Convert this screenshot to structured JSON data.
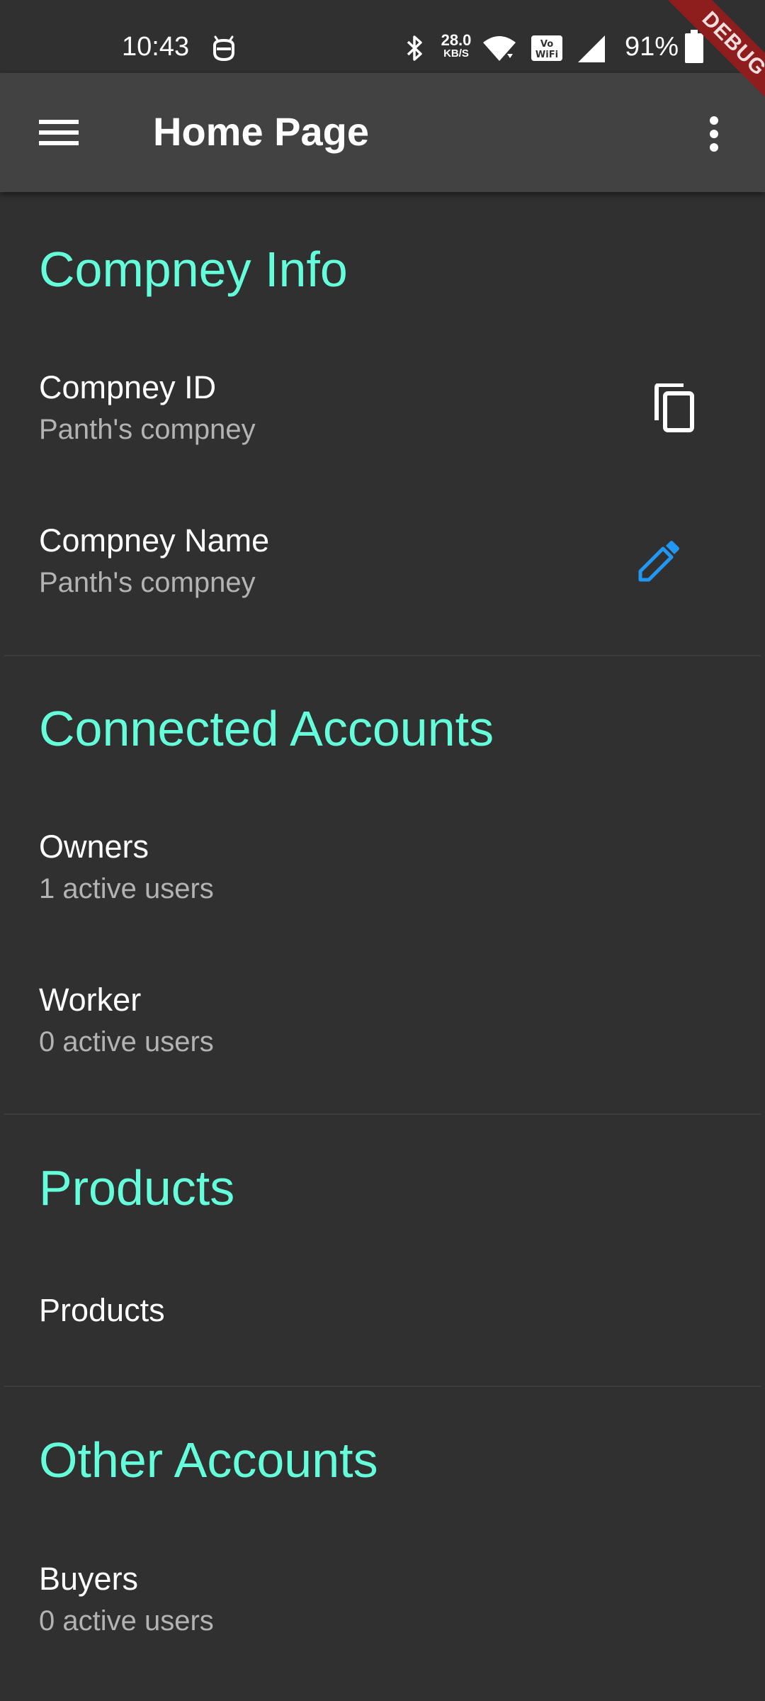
{
  "status_bar": {
    "time": "10:43",
    "net_speed_value": "28.0",
    "net_speed_unit": "KB/S",
    "battery_percent": "91%",
    "icons": [
      "android-face-icon",
      "bluetooth-icon",
      "wifi-icon",
      "vowifi-icon",
      "cell-signal-icon",
      "battery-icon"
    ]
  },
  "debug_banner": "DEBUG",
  "app_bar": {
    "title": "Home Page",
    "leading_icon": "menu-icon",
    "trailing_icon": "more-vert-icon"
  },
  "sections": {
    "company_info": {
      "title": "Compney Info",
      "items": [
        {
          "title": "Compney ID",
          "subtitle": "Panth's compney",
          "action_icon": "copy-icon"
        },
        {
          "title": "Compney Name",
          "subtitle": "Panth's compney",
          "action_icon": "edit-icon"
        }
      ]
    },
    "connected_accounts": {
      "title": "Connected Accounts",
      "items": [
        {
          "title": "Owners",
          "subtitle": "1 active users"
        },
        {
          "title": "Worker",
          "subtitle": "0 active users"
        }
      ]
    },
    "products": {
      "title": "Products",
      "items": [
        {
          "title": "Products"
        }
      ]
    },
    "other_accounts": {
      "title": "Other Accounts",
      "items": [
        {
          "title": "Buyers",
          "subtitle": "0 active users"
        }
      ]
    }
  },
  "colors": {
    "background": "#303030",
    "app_bar": "#424242",
    "accent": "#64ffda",
    "edit_icon": "#2196f3",
    "subtitle": "#b3b3b3",
    "debug_ribbon": "#8e1d1d"
  }
}
